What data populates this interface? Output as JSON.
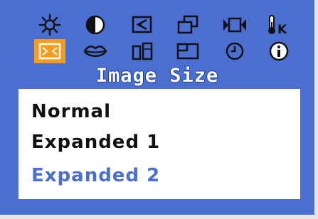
{
  "menu": {
    "title": "Image Size",
    "icons": [
      "brightness-icon",
      "contrast-icon",
      "position-icon",
      "size-icon",
      "video-input-icon",
      "color-temperature-icon",
      "image-size-icon",
      "lips-icon",
      "split-icon",
      "window-icon",
      "clock-icon",
      "information-icon"
    ],
    "selected_icon": "image-size-icon",
    "color_temperature_glyph": "K",
    "options": [
      {
        "label": "Normal",
        "selected": false
      },
      {
        "label": "Expanded 1",
        "selected": false
      },
      {
        "label": "Expanded 2",
        "selected": true
      }
    ]
  },
  "colors": {
    "panel": "#4a6fd0",
    "selected_icon_bg": "#f59b1e",
    "options_bg": "#ffffff",
    "option_text": "#111111",
    "selected_option_text": "#4a6fd0"
  }
}
